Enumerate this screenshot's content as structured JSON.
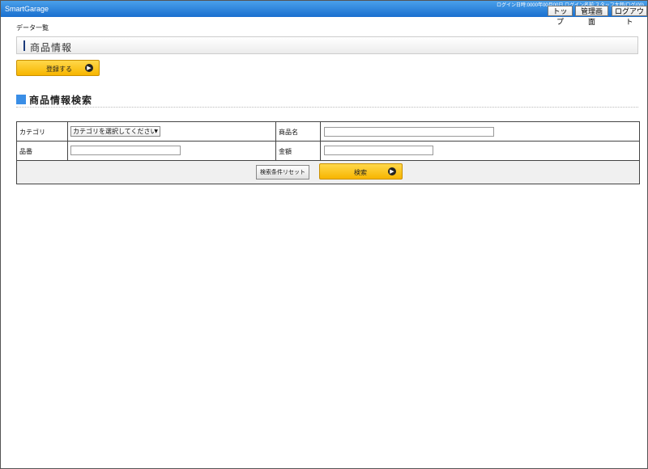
{
  "header": {
    "brand": "SmartGarage",
    "login_info": "ログイン日時:0000年00月00日 ログイン名前:スタッフ太郎/ログ(00)",
    "buttons": {
      "top": "トップ",
      "admin": "管理画面",
      "logout": "ログアウト"
    }
  },
  "breadcrumb": "データ一覧",
  "page_title": "商品情報",
  "register_button": "登録する",
  "search": {
    "section_title": "商品情報検索",
    "fields": {
      "category_label": "カテゴリ",
      "category_select": "カテゴリを選択してください",
      "product_name_label": "商品名",
      "product_name_value": "",
      "part_number_label": "品番",
      "part_number_value": "",
      "price_label": "金額",
      "price_value": ""
    },
    "reset_button": "検索条件リセット",
    "search_button": "検索"
  },
  "icons": {
    "arrow": "arrow-right-circle-icon",
    "dropdown": "dropdown-arrow-icon"
  },
  "colors": {
    "header": "#1a6fcf",
    "accent_button": "#f7b500",
    "section_icon": "#3a8ee6"
  }
}
